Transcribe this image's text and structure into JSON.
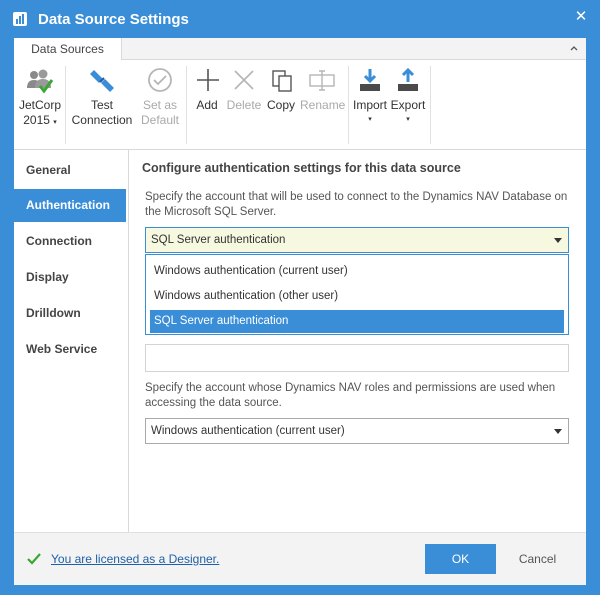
{
  "window": {
    "title": "Data Source Settings",
    "close_label": "✕"
  },
  "ribbon": {
    "tab_label": "Data Sources",
    "buttons": {
      "jetcorp": {
        "line1": "JetCorp",
        "line2": "2015"
      },
      "test": {
        "line1": "Test",
        "line2": "Connection"
      },
      "set_default": {
        "line1": "Set as",
        "line2": "Default"
      },
      "add": "Add",
      "delete": "Delete",
      "copy": "Copy",
      "rename": "Rename",
      "import": "Import",
      "export": "Export"
    },
    "dropdown_arrow": "▾"
  },
  "sidebar": {
    "items": [
      {
        "label": "General"
      },
      {
        "label": "Authentication"
      },
      {
        "label": "Connection"
      },
      {
        "label": "Display"
      },
      {
        "label": "Drilldown"
      },
      {
        "label": "Web Service"
      }
    ],
    "active": "Authentication"
  },
  "panel": {
    "title": "Configure authentication settings for this data source",
    "desc1": "Specify the account that will be used to connect to the Dynamics NAV Database on the Microsoft SQL Server.",
    "combo1_value": "SQL Server authentication",
    "dropdown_options": [
      "Windows authentication (current user)",
      "Windows authentication (other user)",
      "SQL Server authentication"
    ],
    "selected_option": "SQL Server authentication",
    "textbox_value": "",
    "desc2": "Specify the account whose Dynamics NAV roles and permissions are used when accessing the data source.",
    "combo2_value": "Windows authentication (current user)"
  },
  "footer": {
    "license_text": "You are licensed as a Designer.",
    "ok_label": "OK",
    "cancel_label": "Cancel"
  },
  "colors": {
    "accent": "#3a8ed8",
    "focused_field_bg": "#f6f9e0",
    "check_green": "#3aa635"
  }
}
